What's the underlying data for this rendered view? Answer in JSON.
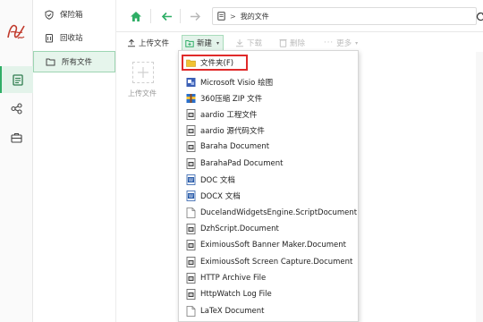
{
  "sidebar": {
    "items": [
      {
        "label": "保险箱",
        "icon": "shield-icon"
      },
      {
        "label": "回收站",
        "icon": "trash-icon"
      },
      {
        "label": "所有文件",
        "icon": "folder-icon",
        "active": true
      }
    ]
  },
  "rail": {
    "items": [
      {
        "icon": "document-icon",
        "active": true
      },
      {
        "icon": "share-icon"
      },
      {
        "icon": "briefcase-icon"
      }
    ]
  },
  "breadcrumb": {
    "current": "我的文件"
  },
  "toolbar": {
    "upload": "上传文件",
    "new": "新建",
    "download": "下载",
    "delete": "删除",
    "more": "更多"
  },
  "content": {
    "upload_label": "上传文件"
  },
  "menu": {
    "items": [
      {
        "label": "文件夹(F)",
        "icon": "folder-icon",
        "highlighted": true
      },
      {
        "label": "Microsoft Visio 绘图",
        "icon": "visio-icon"
      },
      {
        "label": "360压缩 ZIP 文件",
        "icon": "zip-icon"
      },
      {
        "label": "aardio 工程文件",
        "icon": "file-icon"
      },
      {
        "label": "aardio 源代码文件",
        "icon": "file-icon"
      },
      {
        "label": "Baraha Document",
        "icon": "file-icon"
      },
      {
        "label": "BarahaPad Document",
        "icon": "file-icon"
      },
      {
        "label": "DOC 文档",
        "icon": "doc-icon"
      },
      {
        "label": "DOCX 文档",
        "icon": "doc-icon"
      },
      {
        "label": "DucelandWidgetsEngine.ScriptDocument",
        "icon": "blank-file-icon"
      },
      {
        "label": "DzhScript.Document",
        "icon": "file-icon"
      },
      {
        "label": "EximiousSoft Banner Maker.Document",
        "icon": "file-icon"
      },
      {
        "label": "EximiousSoft Screen Capture.Document",
        "icon": "file-icon"
      },
      {
        "label": "HTTP Archive File",
        "icon": "file-icon"
      },
      {
        "label": "HttpWatch Log File",
        "icon": "file-icon"
      },
      {
        "label": "LaTeX Document",
        "icon": "blank-file-icon"
      }
    ]
  },
  "colors": {
    "accent": "#2fae66",
    "highlight_border": "#e02a2a"
  }
}
